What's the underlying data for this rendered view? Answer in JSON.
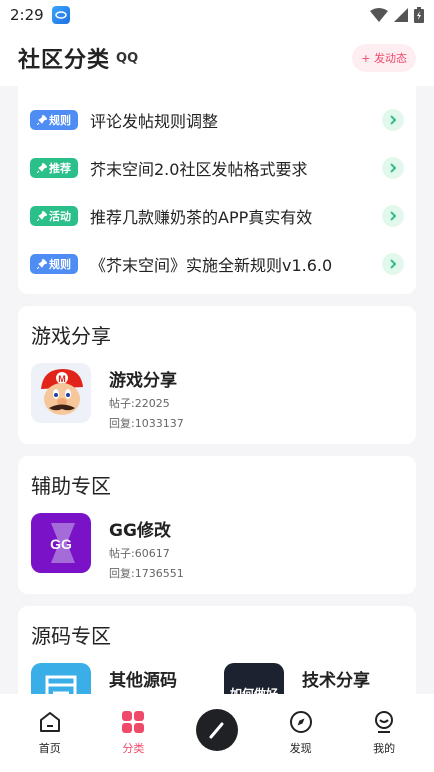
{
  "status_bar": {
    "time": "2:29"
  },
  "header": {
    "title": "社区分类",
    "badge": "QQ",
    "post_button": "+ 发动态"
  },
  "notices": [
    {
      "tag": "规则",
      "tag_color": "#4f8df5",
      "text": "评论发帖规则调整"
    },
    {
      "tag": "推荐",
      "tag_color": "#2bbf8a",
      "text": "芥末空间2.0社区发帖格式要求"
    },
    {
      "tag": "活动",
      "tag_color": "#2bbf8a",
      "text": "推荐几款赚奶茶的APP真实有效"
    },
    {
      "tag": "规则",
      "tag_color": "#4f8df5",
      "text": "《芥末空间》实施全新规则v1.6.0"
    }
  ],
  "sections": [
    {
      "title": "游戏分享",
      "forums": [
        {
          "name": "游戏分享",
          "posts": "帖子:22025",
          "replies": "回复:1033137",
          "icon": "mario-icon"
        }
      ]
    },
    {
      "title": "辅助专区",
      "forums": [
        {
          "name": "GG修改",
          "posts": "帖子:60617",
          "replies": "回复:1736551",
          "icon": "gg-icon"
        }
      ]
    },
    {
      "title": "源码专区",
      "forums": [
        {
          "name": "其他源码",
          "icon": "code-doc-icon"
        },
        {
          "name": "技术分享",
          "icon_text": "如何做好",
          "icon": "tech-share-icon"
        }
      ]
    }
  ],
  "tabbar": [
    {
      "label": "首页",
      "icon": "home-icon"
    },
    {
      "label": "分类",
      "icon": "category-icon",
      "active": true
    },
    {
      "label": "",
      "icon": "pen-icon"
    },
    {
      "label": "发现",
      "icon": "compass-icon"
    },
    {
      "label": "我的",
      "icon": "profile-icon"
    }
  ],
  "colors": {
    "accent": "#f04a6a",
    "green": "#2bbf8a",
    "blue": "#4f8df5"
  }
}
